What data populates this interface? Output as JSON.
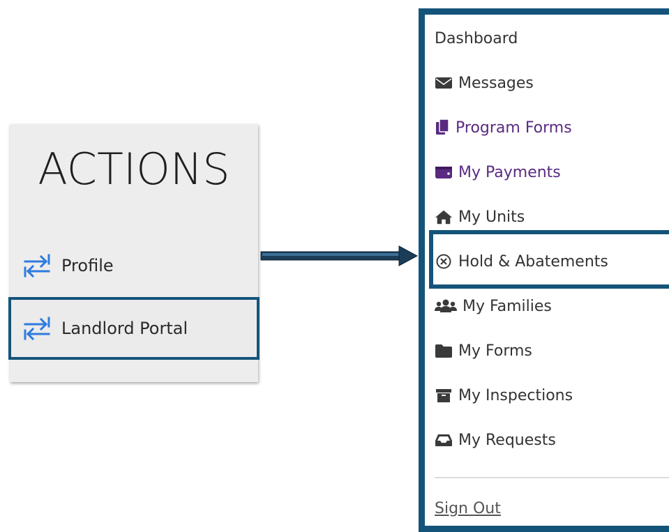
{
  "actions": {
    "title": "ACTIONS",
    "items": [
      {
        "label": "Profile",
        "icon": "swap-arrows-icon"
      },
      {
        "label": "Landlord Portal",
        "icon": "swap-arrows-icon",
        "highlighted": true
      }
    ]
  },
  "menu": {
    "items": [
      {
        "label": "Dashboard",
        "icon": ""
      },
      {
        "label": "Messages",
        "icon": "envelope-icon"
      },
      {
        "label": "Program Forms",
        "icon": "documents-icon"
      },
      {
        "label": "My Payments",
        "icon": "wallet-icon"
      },
      {
        "label": "My Units",
        "icon": "home-icon"
      },
      {
        "label": "Hold & Abatements",
        "icon": "circle-x-icon",
        "highlighted": true
      },
      {
        "label": "My Families",
        "icon": "users-icon"
      },
      {
        "label": "My Forms",
        "icon": "folder-icon"
      },
      {
        "label": "My Inspections",
        "icon": "archive-icon"
      },
      {
        "label": "My Requests",
        "icon": "inbox-icon"
      }
    ],
    "sign_out": "Sign Out"
  },
  "colors": {
    "highlight_border": "#14547a",
    "icon_blue": "#2e7be0",
    "purple_text": "#5a2a82",
    "text": "#333333"
  }
}
